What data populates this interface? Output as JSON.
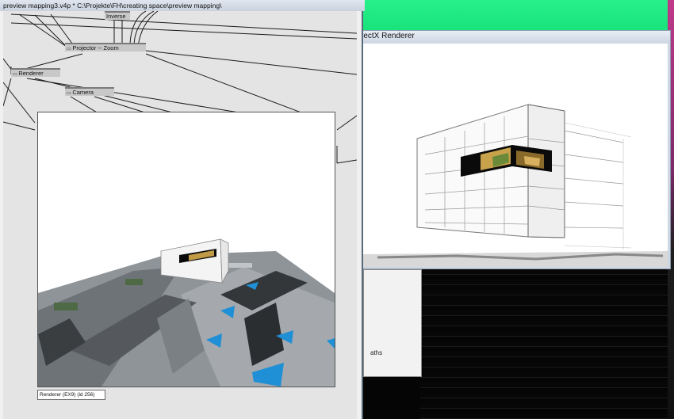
{
  "patch_window": {
    "title": "preview mapping3.v4p *  C:\\Projekte\\FH\\creating space\\preview mapping\\",
    "nodes": {
      "inverse": "Inverse",
      "projector_zoom": "Projector -- Zoom",
      "renderer": "Renderer",
      "camera": "Camera"
    },
    "renderer_label": "Renderer (EX9) (id 256)"
  },
  "dx_window": {
    "title": "rectX Renderer"
  },
  "gray_panel": {
    "text": "aths"
  },
  "colors": {
    "desktop_green": "#1fe884",
    "accent_blue": "#1f8fd6"
  }
}
